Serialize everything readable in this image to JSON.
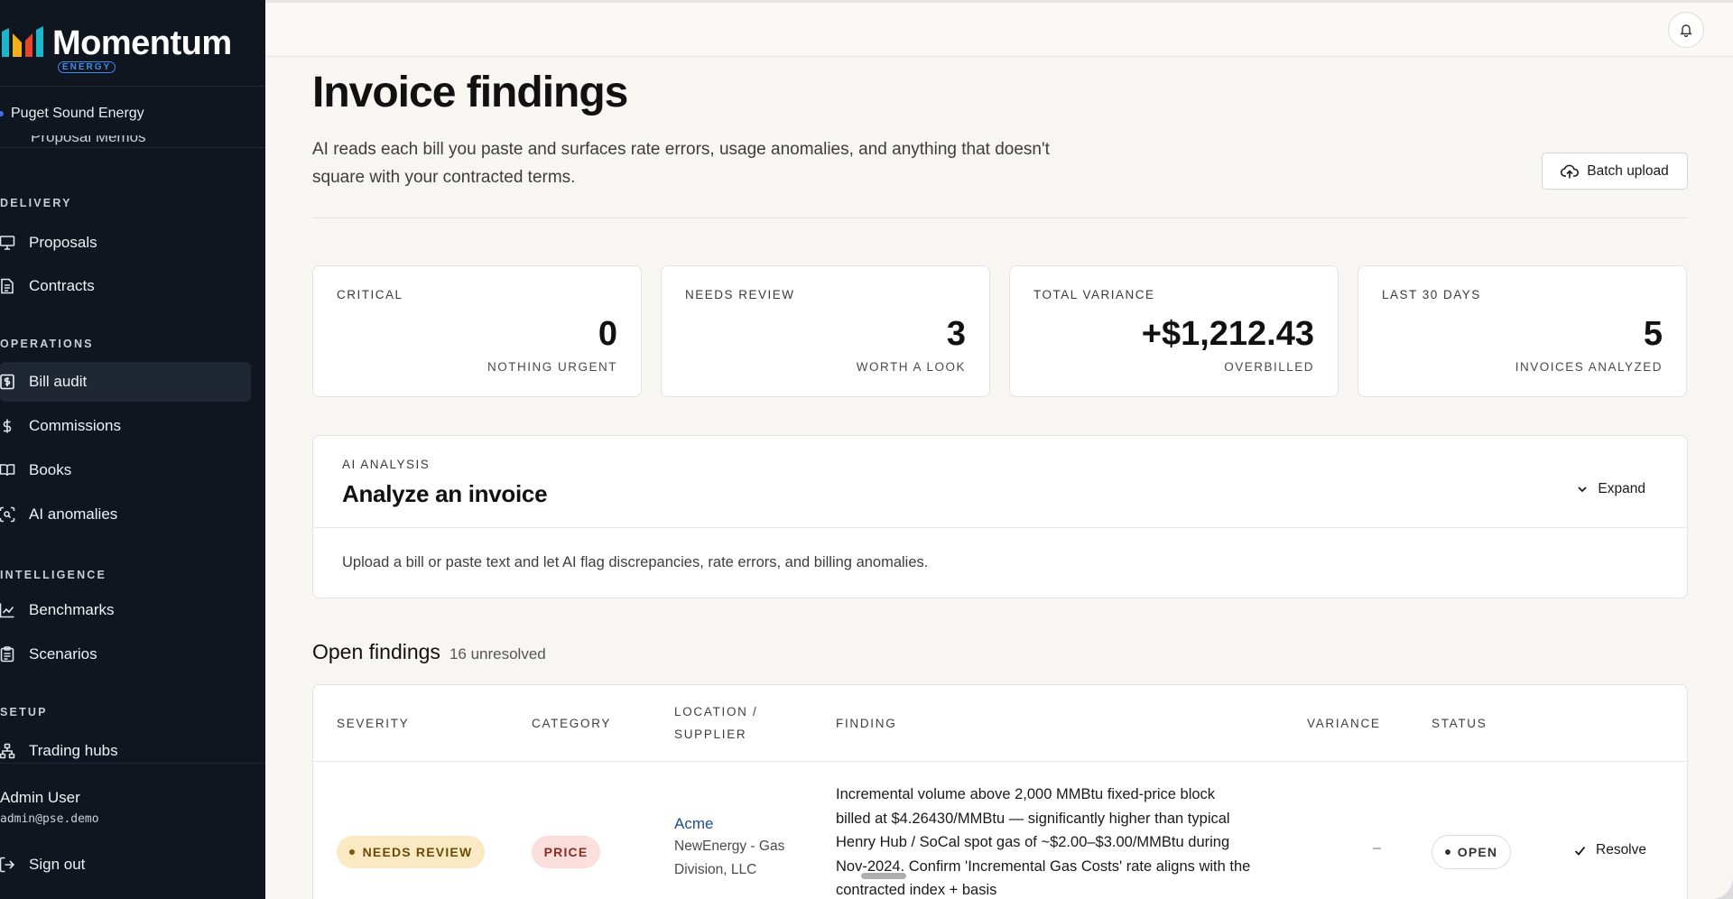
{
  "sidebar": {
    "brand": {
      "name": "Momentum",
      "sub": "ENERGY"
    },
    "org": "Puget Sound Energy",
    "cut_item": "Proposal Memos",
    "sections": {
      "delivery": "DELIVERY",
      "operations": "OPERATIONS",
      "intelligence": "INTELLIGENCE",
      "setup": "SETUP"
    },
    "items": {
      "proposals": "Proposals",
      "contracts": "Contracts",
      "bill_audit": "Bill audit",
      "commissions": "Commissions",
      "books": "Books",
      "ai_anomalies": "AI anomalies",
      "benchmarks": "Benchmarks",
      "scenarios": "Scenarios",
      "trading_hubs": "Trading hubs"
    },
    "user": {
      "name": "Admin User",
      "email": "admin@pse.demo"
    },
    "sign_out": "Sign out"
  },
  "header": {
    "title": "Invoice findings",
    "description": "AI reads each bill you paste and surfaces rate errors, usage anomalies, and anything that doesn't square with your contracted terms.",
    "batch_upload": "Batch upload"
  },
  "stats": [
    {
      "label": "CRITICAL",
      "value": "0",
      "sub": "NOTHING URGENT"
    },
    {
      "label": "NEEDS REVIEW",
      "value": "3",
      "sub": "WORTH A LOOK"
    },
    {
      "label": "TOTAL VARIANCE",
      "value": "+$1,212.43",
      "sub": "OVERBILLED"
    },
    {
      "label": "LAST 30 DAYS",
      "value": "5",
      "sub": "INVOICES ANALYZED"
    }
  ],
  "analyze": {
    "eyebrow": "AI ANALYSIS",
    "title": "Analyze an invoice",
    "expand": "Expand",
    "help": "Upload a bill or paste text and let AI flag discrepancies, rate errors, and billing anomalies."
  },
  "findings": {
    "title": "Open findings",
    "count": "16 unresolved",
    "columns": {
      "severity": "SEVERITY",
      "category": "CATEGORY",
      "location": "LOCATION / SUPPLIER",
      "finding": "FINDING",
      "variance": "VARIANCE",
      "status": "STATUS"
    },
    "rows": [
      {
        "severity": "NEEDS REVIEW",
        "category": "PRICE",
        "location": "Acme",
        "supplier": "NewEnergy - Gas Division, LLC",
        "finding": "Incremental volume above 2,000 MMBtu fixed-price block billed at $4.26430/MMBtu — significantly higher than typical Henry Hub / SoCal spot gas of ~$2.00–$3.00/MMBtu during Nov-2024. Confirm 'Incremental Gas Costs' rate aligns with the contracted index + basis",
        "variance": "–",
        "status": "OPEN",
        "action": "Resolve"
      }
    ]
  },
  "colors": {
    "sidebar_bg": "#0f1620",
    "page_bg": "#f7f6f3",
    "needs_review_bg": "#fbe9c4",
    "price_bg": "#fbdfdd",
    "link": "#1f4c8f"
  }
}
